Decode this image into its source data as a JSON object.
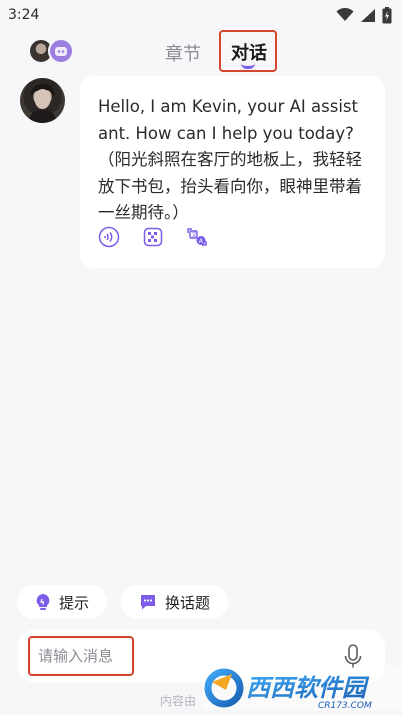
{
  "status_bar": {
    "time": "3:24",
    "icons": [
      "wifi-icon",
      "signal-icon",
      "battery-icon"
    ]
  },
  "header": {
    "tabs": [
      {
        "label": "章节",
        "active": false
      },
      {
        "label": "对话",
        "active": true
      }
    ]
  },
  "message": {
    "sender": "Kevin",
    "text": "Hello, I am Kevin, your AI assistant. How can I help you today?（阳光斜照在客厅的地板上，我轻轻放下书包，抬头看向你，眼神里带着一丝期待。）",
    "actions": [
      "audio-icon",
      "pattern-icon",
      "translate-icon"
    ]
  },
  "suggestions": {
    "hint_label": "提示",
    "topic_label": "换话题"
  },
  "input": {
    "placeholder": "请输入消息",
    "value": ""
  },
  "footer": {
    "note": "内容由"
  },
  "watermark": {
    "text": "西西软件园",
    "url_text": "CR173.COM"
  },
  "colors": {
    "accent": "#7c5ce8",
    "highlight_box": "#d4452e",
    "background": "#f7f7f9"
  }
}
